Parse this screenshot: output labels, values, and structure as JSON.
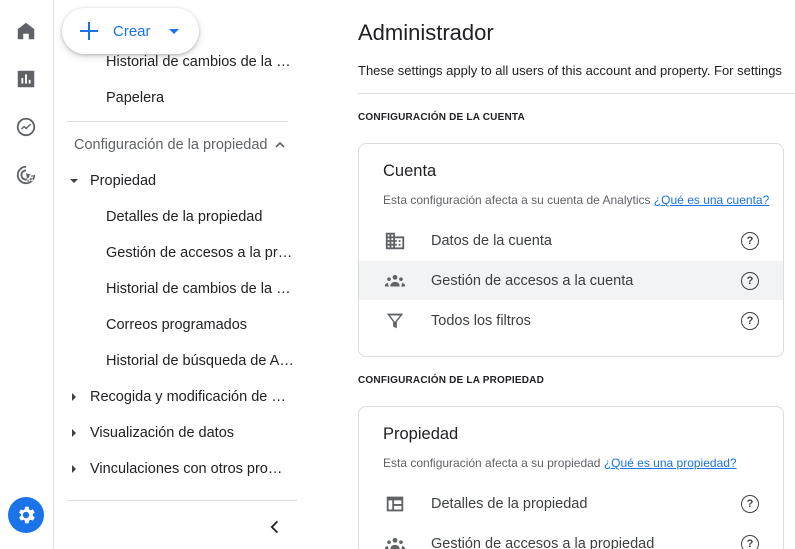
{
  "create_button": {
    "label": "Crear"
  },
  "rail": {
    "icons": [
      "home-icon",
      "reports-icon",
      "explore-icon",
      "advertising-icon"
    ],
    "settings_icon": "gear-icon",
    "accent_color": "#1a73e8"
  },
  "nav": {
    "top_items": [
      {
        "label": "Historial de cambios de la cuenta"
      },
      {
        "label": "Papelera"
      }
    ],
    "property_section_label": "Configuración de la propiedad",
    "propiedad_group": {
      "label": "Propiedad",
      "items": [
        {
          "label": "Detalles de la propiedad"
        },
        {
          "label": "Gestión de accesos a la propiedad"
        },
        {
          "label": "Historial de cambios de la propiedad"
        },
        {
          "label": "Correos programados"
        },
        {
          "label": "Historial de búsqueda de Analytics"
        }
      ]
    },
    "collapsed_groups": [
      {
        "label": "Recogida y modificación de datos"
      },
      {
        "label": "Visualización de datos"
      },
      {
        "label": "Vinculaciones con otros productos"
      }
    ]
  },
  "main": {
    "title": "Administrador",
    "subtitle": "These settings apply to all users of this account and property. For settings",
    "account_section": {
      "category": "CONFIGURACIÓN DE LA CUENTA",
      "card_title": "Cuenta",
      "description": "Esta configuración afecta a su cuenta de Analytics",
      "help_link": "¿Qué es una cuenta?",
      "rows": [
        {
          "label": "Datos de la cuenta",
          "icon": "building-icon"
        },
        {
          "label": "Gestión de accesos a la cuenta",
          "icon": "people-icon"
        },
        {
          "label": "Todos los filtros",
          "icon": "filter-icon"
        }
      ]
    },
    "property_section": {
      "category": "CONFIGURACIÓN DE LA PROPIEDAD",
      "card_title": "Propiedad",
      "description": "Esta configuración afecta a su propiedad",
      "help_link": "¿Qué es una propiedad?",
      "rows": [
        {
          "label": "Detalles de la propiedad",
          "icon": "web-icon"
        },
        {
          "label": "Gestión de accesos a la propiedad",
          "icon": "people-icon"
        }
      ]
    },
    "help_glyph": "?"
  }
}
